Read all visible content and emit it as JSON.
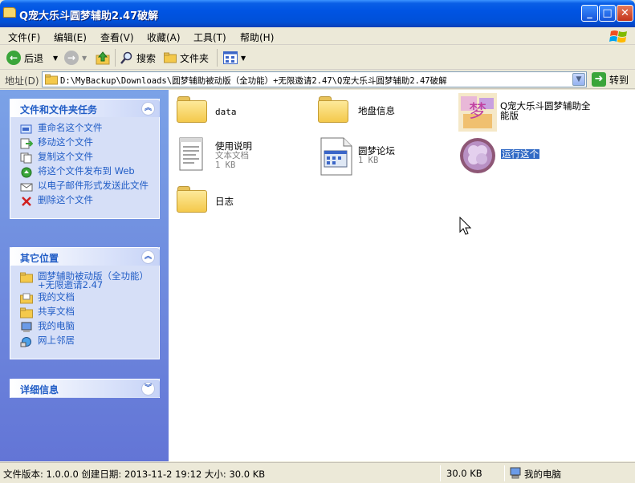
{
  "window": {
    "title": "Q宠大乐斗圆梦辅助2.47破解",
    "minimize": "_",
    "maximize": "□",
    "close": "✕"
  },
  "menu": [
    "文件(F)",
    "编辑(E)",
    "查看(V)",
    "收藏(A)",
    "工具(T)",
    "帮助(H)"
  ],
  "toolbar": {
    "back": "后退",
    "search": "搜索",
    "folders": "文件夹"
  },
  "address": {
    "label": "地址(D)",
    "path": "D:\\MyBackup\\Downloads\\圆梦辅助被动版（全功能）+无限邀请2.47\\Q宠大乐斗圆梦辅助2.47破解",
    "go": "转到"
  },
  "tasks": {
    "file_tasks": {
      "title": "文件和文件夹任务",
      "items": [
        "重命名这个文件",
        "移动这个文件",
        "复制这个文件",
        "将这个文件发布到 Web",
        "以电子邮件形式发送此文件",
        "删除这个文件"
      ]
    },
    "other_places": {
      "title": "其它位置",
      "items": [
        "圆梦辅助被动版（全功能）+无限邀请2.47",
        "我的文档",
        "共享文档",
        "我的电脑",
        "网上邻居"
      ]
    },
    "details": {
      "title": "详细信息"
    }
  },
  "files": [
    {
      "name": "data",
      "type": "folder"
    },
    {
      "name": "地盘信息",
      "type": "folder"
    },
    {
      "name": "Q宠大乐斗圆梦辅助全能版",
      "type": "image"
    },
    {
      "name": "使用说明",
      "line2": "文本文档",
      "line3": "1 KB",
      "type": "text"
    },
    {
      "name": "圆梦论坛",
      "line2": "1 KB",
      "type": "shortcut"
    },
    {
      "name": "运行这个",
      "type": "app",
      "selected": true
    },
    {
      "name": "日志",
      "type": "folder"
    }
  ],
  "status": {
    "info": "文件版本: 1.0.0.0 创建日期: 2013-11-2 19:12 大小: 30.0 KB",
    "size": "30.0 KB",
    "zone": "我的电脑"
  }
}
